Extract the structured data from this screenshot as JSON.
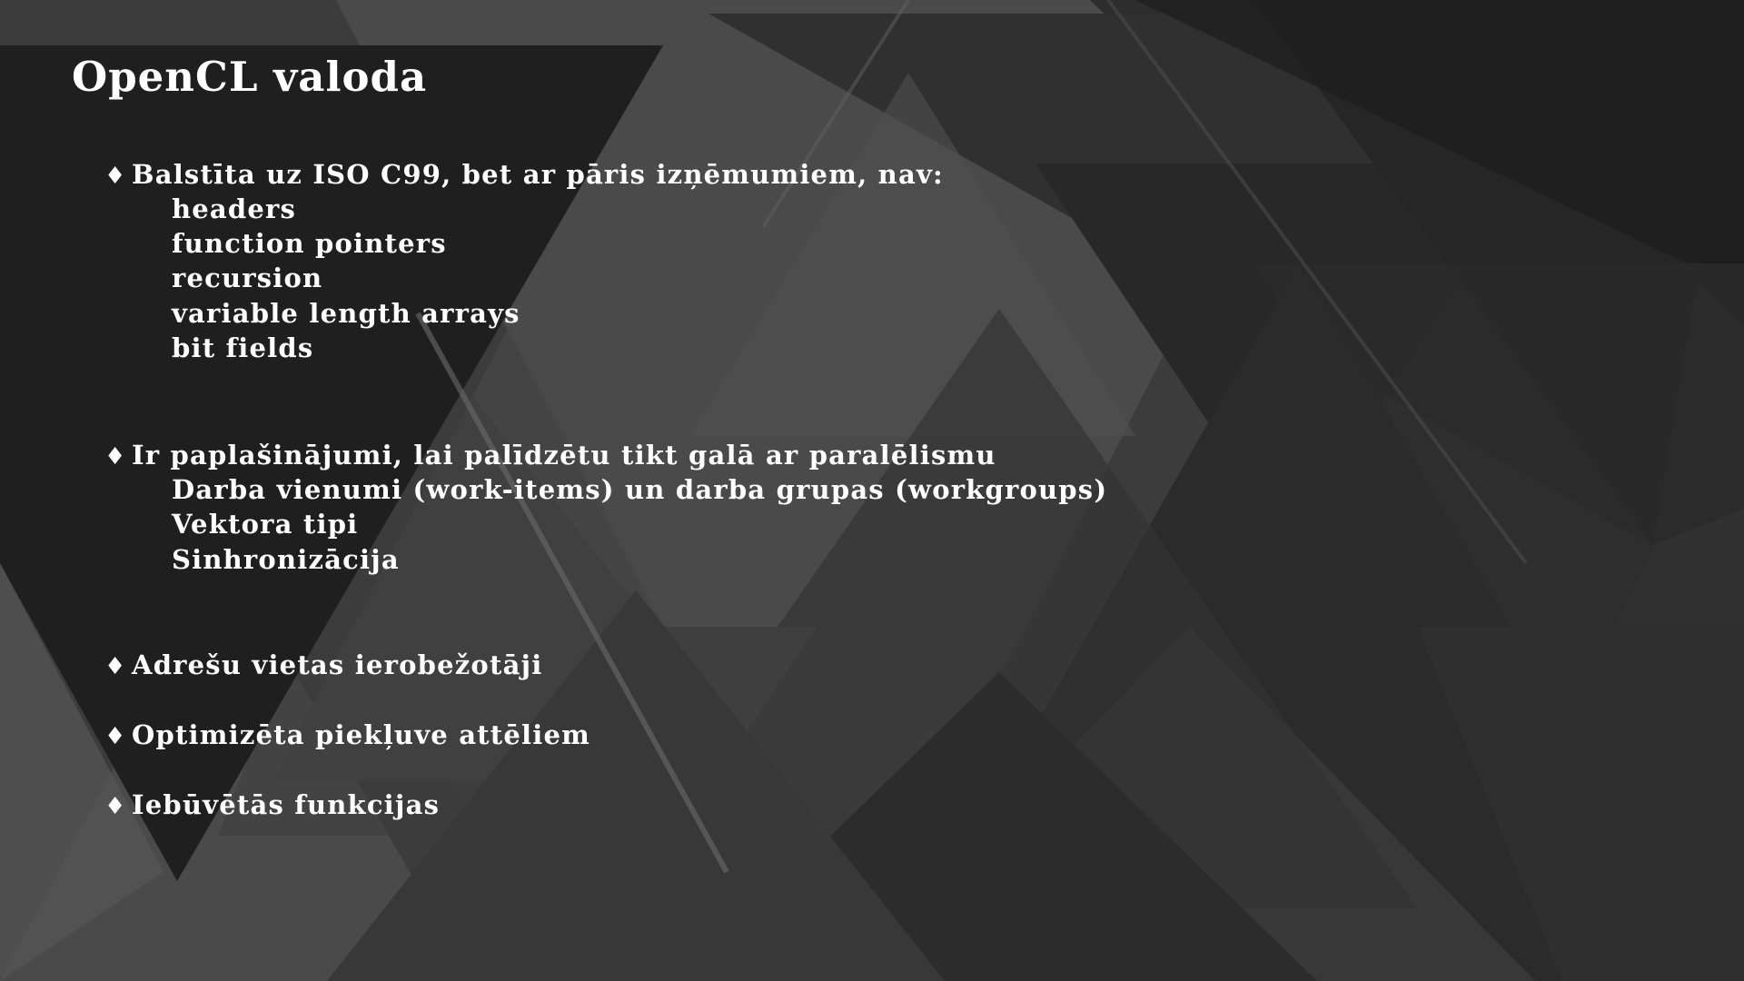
{
  "slide": {
    "title": "OpenCL valoda",
    "bullet_symbol": "♦",
    "bullets": [
      {
        "text": "Balstīta uz ISO C99, bet ar pāris izņēmumiem, nav:",
        "subitems": [
          "headers",
          "function pointers",
          "recursion",
          "variable length arrays",
          "bit fields"
        ]
      },
      {
        "text": "Ir paplašinājumi, lai palīdzētu tikt galā ar paralēlismu",
        "subitems": [
          "Darba vienumi (work-items) un darba grupas (workgroups)",
          "Vektora tipi",
          "Sinhronizācija"
        ]
      },
      {
        "text": "Adrešu vietas ierobežotāji",
        "subitems": []
      },
      {
        "text": "Optimizēta piekļuve attēliem",
        "subitems": []
      },
      {
        "text": "Iebūvētās funkcijas",
        "subitems": []
      }
    ]
  },
  "colors": {
    "text": "#ffffff",
    "background": "#3a3a3a"
  }
}
